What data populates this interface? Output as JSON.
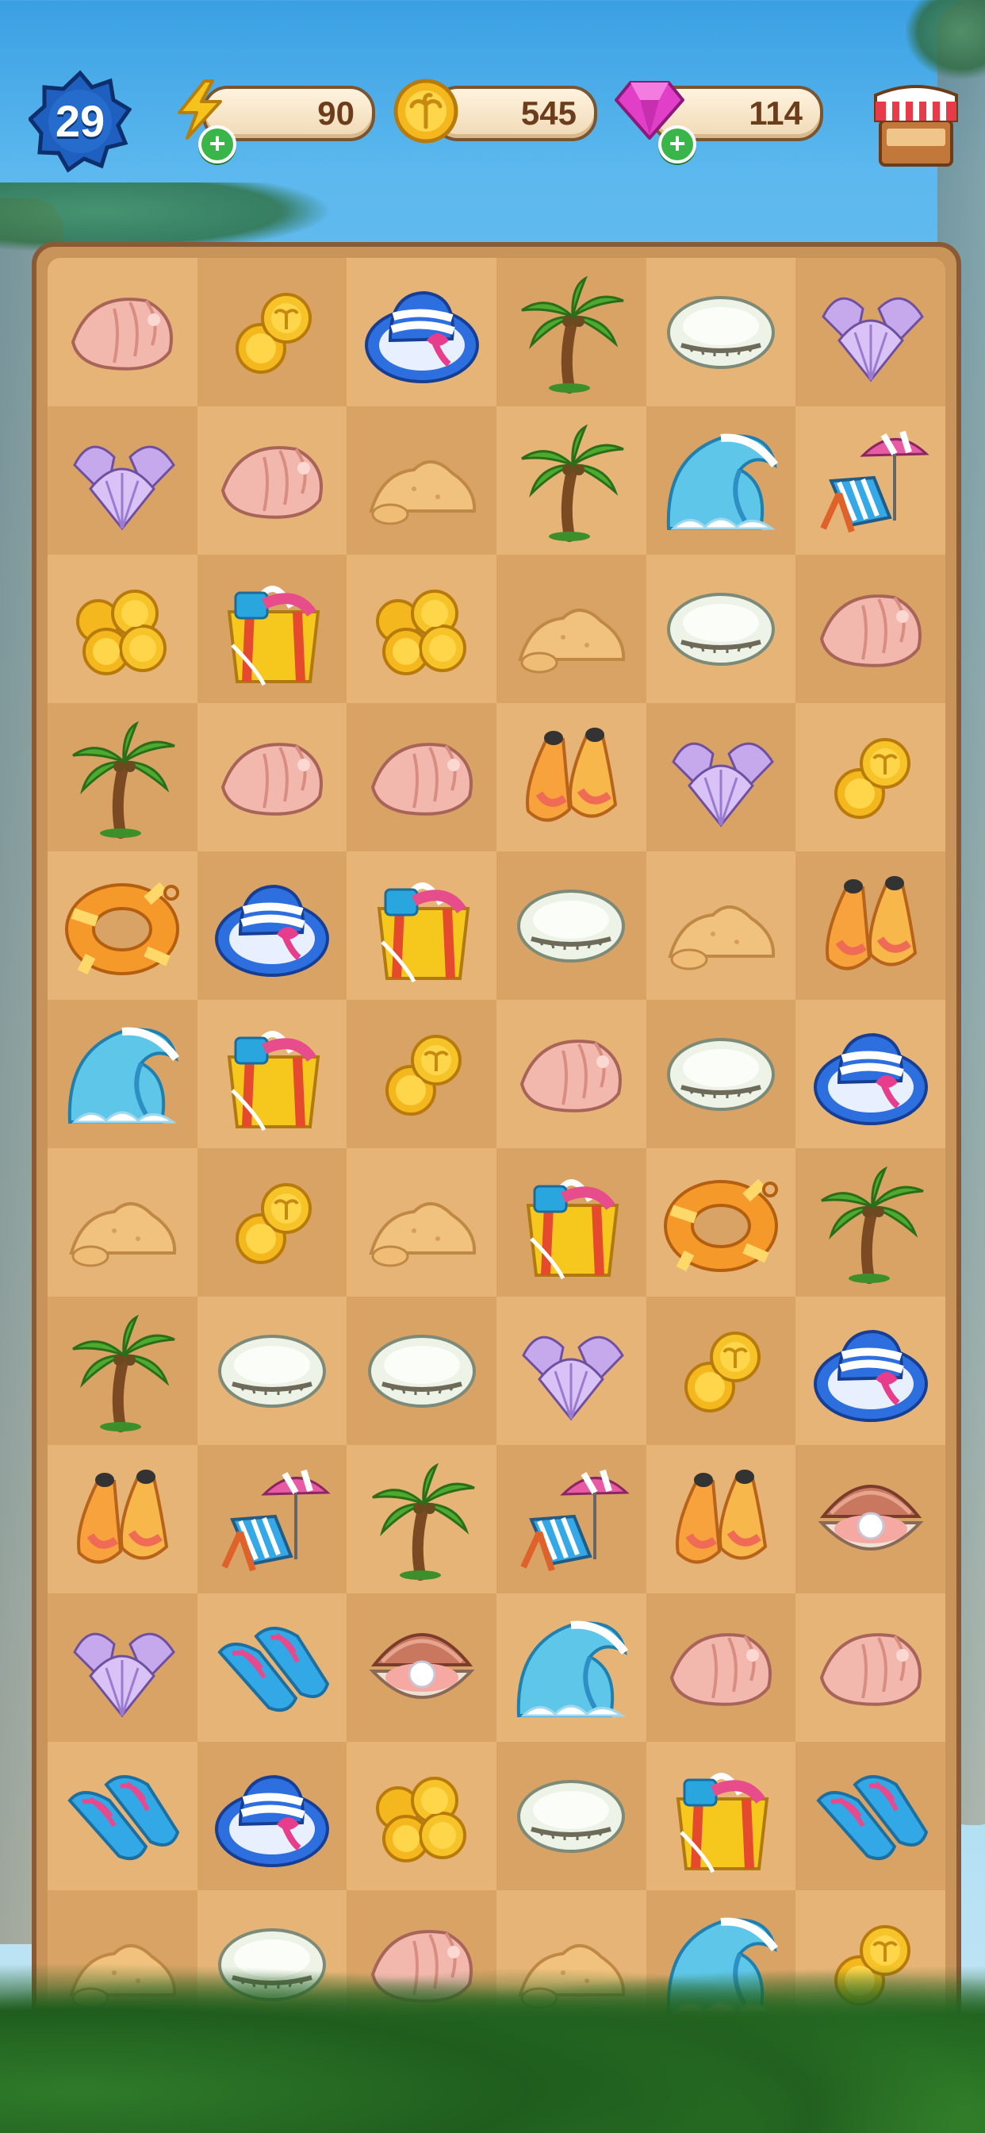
{
  "hud": {
    "level": "29",
    "energy": "90",
    "coins": "545",
    "gems": "114"
  },
  "board": {
    "columns": 6,
    "rows": [
      [
        "conch-shell",
        "gold-coins-small",
        "sun-hat",
        "palm-tree",
        "cowrie-shell",
        "purple-scallops"
      ],
      [
        "purple-scallops",
        "conch-shell",
        "sand-pile",
        "palm-tree",
        "ocean-wave",
        "beach-chair-umbrella"
      ],
      [
        "gold-coins-stack",
        "beach-bag",
        "gold-coins-stack",
        "sand-pile",
        "cowrie-shell",
        "conch-shell"
      ],
      [
        "palm-tree",
        "conch-shell",
        "conch-shell",
        "swim-fins",
        "purple-scallops",
        "gold-coins-small"
      ],
      [
        "swim-ring",
        "sun-hat",
        "beach-bag",
        "cowrie-shell",
        "sand-pile",
        "swim-fins"
      ],
      [
        "ocean-wave",
        "beach-bag",
        "gold-coins-small",
        "conch-shell",
        "cowrie-shell",
        "sun-hat"
      ],
      [
        "sand-pile",
        "gold-coins-small",
        "sand-pile",
        "beach-bag",
        "swim-ring",
        "palm-tree"
      ],
      [
        "palm-tree",
        "cowrie-shell",
        "cowrie-shell",
        "purple-scallops",
        "gold-coins-small",
        "sun-hat"
      ],
      [
        "swim-fins",
        "beach-chair-umbrella",
        "palm-tree",
        "beach-chair-umbrella",
        "swim-fins",
        "pearl-oyster"
      ],
      [
        "purple-scallops",
        "flip-flops",
        "pearl-oyster",
        "ocean-wave",
        "conch-shell",
        "conch-shell"
      ],
      [
        "flip-flops",
        "sun-hat",
        "gold-coins-stack",
        "cowrie-shell",
        "beach-bag",
        "flip-flops"
      ],
      [
        "sand-pile",
        "cowrie-shell",
        "conch-shell",
        "sand-pile",
        "ocean-wave",
        "gold-coins-small"
      ]
    ]
  },
  "colors": {
    "board_frame": "#8a5a34",
    "cell_light": "#e7b477",
    "cell_dark": "#d9a366",
    "plus_green": "#39b54a",
    "level_blue": "#1f5fbf"
  }
}
